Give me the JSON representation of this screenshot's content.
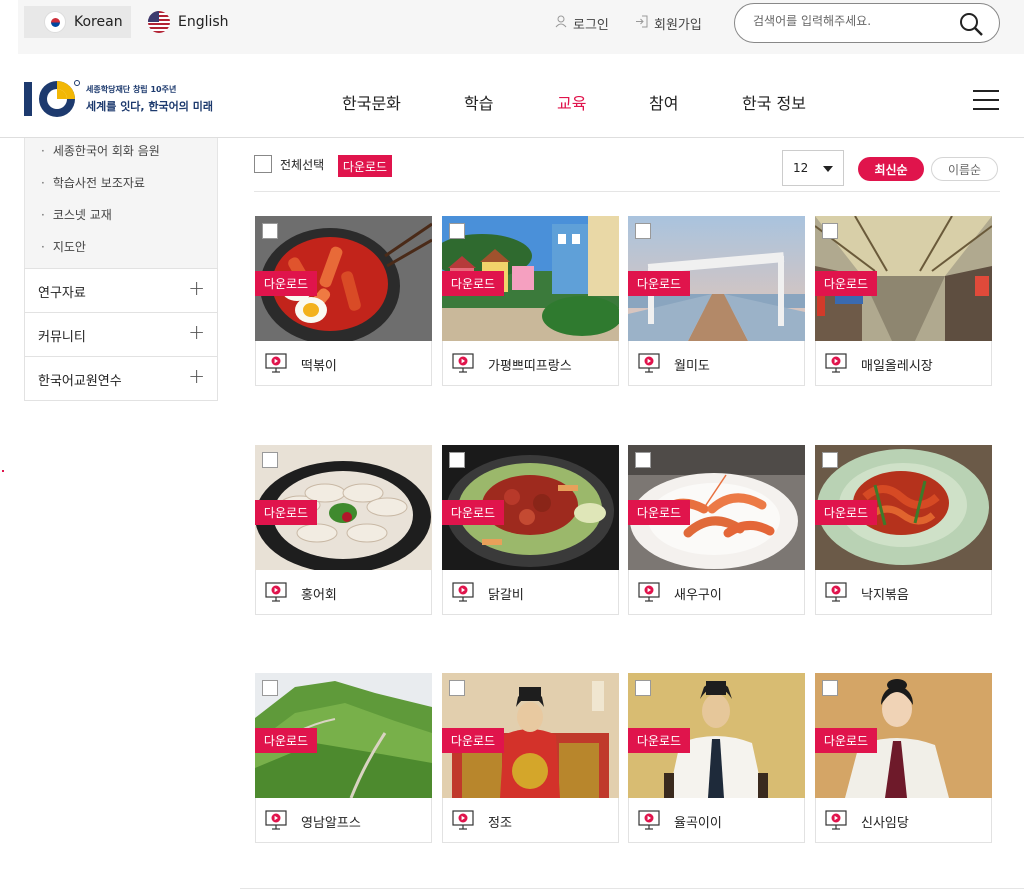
{
  "languages": [
    {
      "label": "Korean",
      "flag": "kr"
    },
    {
      "label": "English",
      "flag": "us"
    }
  ],
  "utility": {
    "login": "로그인",
    "join": "회원가입"
  },
  "search": {
    "placeholder": "검색어를 입력해주세요."
  },
  "logo": {
    "line1": "세종학당재단 창립 10주년",
    "line2": "세계를 잇다, 한국어의 미래"
  },
  "gnb": [
    {
      "label": "한국문화",
      "active": false
    },
    {
      "label": "학습",
      "active": false
    },
    {
      "label": "교육",
      "active": true
    },
    {
      "label": "참여",
      "active": false
    },
    {
      "label": "한국 정보",
      "active": false
    }
  ],
  "sidebar": {
    "sub_items": [
      "세종한국어 회화 음원",
      "학습사전 보조자료",
      "코스넷 교재",
      "지도안"
    ],
    "menus": [
      "연구자료",
      "커뮤니티",
      "한국어교원연수"
    ]
  },
  "toolbar": {
    "select_all": "전체선택",
    "download": "다운로드",
    "per_page": "12",
    "sort_newest": "최신순",
    "sort_name": "이름순"
  },
  "cards": [
    {
      "title": "떡볶이",
      "download": "다운로드",
      "image": "tteokbokki"
    },
    {
      "title": "가평쁘띠프랑스",
      "download": "다운로드",
      "image": "petite-france"
    },
    {
      "title": "월미도",
      "download": "다운로드",
      "image": "wolmido"
    },
    {
      "title": "매일올레시장",
      "download": "다운로드",
      "image": "market"
    },
    {
      "title": "홍어회",
      "download": "다운로드",
      "image": "hongeo"
    },
    {
      "title": "닭갈비",
      "download": "다운로드",
      "image": "dakgalbi"
    },
    {
      "title": "새우구이",
      "download": "다운로드",
      "image": "shrimp"
    },
    {
      "title": "낙지볶음",
      "download": "다운로드",
      "image": "nakji"
    },
    {
      "title": "영남알프스",
      "download": "다운로드",
      "image": "mountain"
    },
    {
      "title": "정조",
      "download": "다운로드",
      "image": "king-jeongjo"
    },
    {
      "title": "율곡이이",
      "download": "다운로드",
      "image": "yulgok"
    },
    {
      "title": "신사임당",
      "download": "다운로드",
      "image": "sinsaimdang"
    }
  ],
  "colors": {
    "accent": "#e0144c",
    "brand_navy": "#1d3a6e"
  }
}
